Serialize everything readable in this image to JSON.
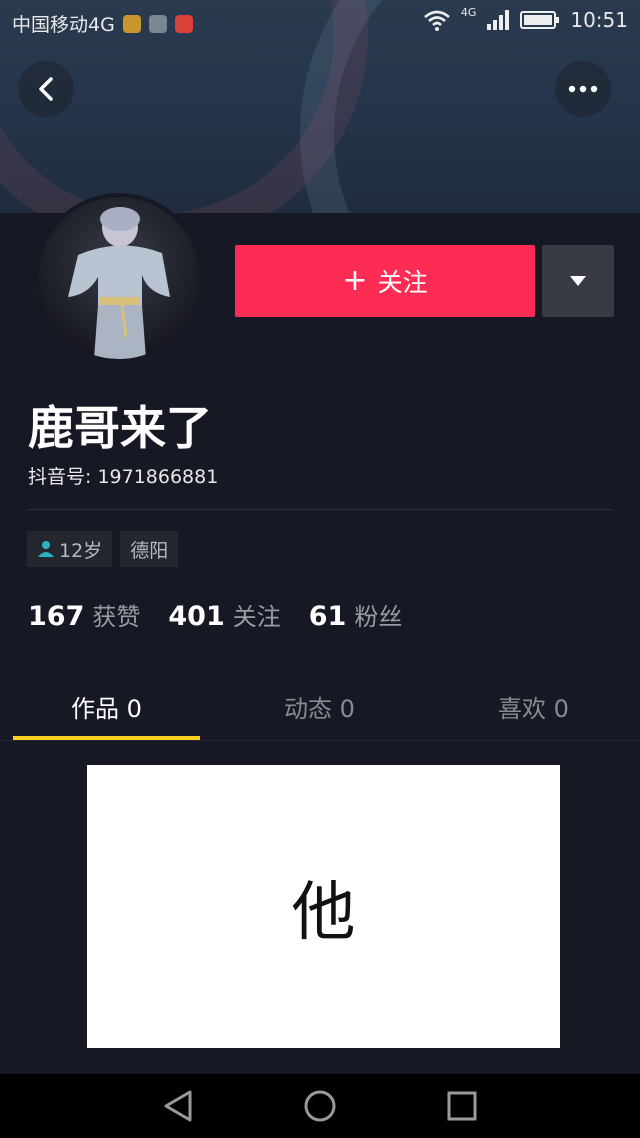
{
  "status_bar": {
    "carrier": "中国移动4G",
    "network": "4G",
    "time": "10:51"
  },
  "header": {
    "back_icon": "chevron-left-icon",
    "more_icon": "more-horizontal-icon"
  },
  "profile": {
    "nickname": "鹿哥来了",
    "account_id": "抖音号: 1971866881",
    "follow_label": "关注",
    "follow_plus": "+",
    "tags": [
      {
        "icon": "person-icon",
        "label": "12岁"
      },
      {
        "label": "德阳"
      }
    ],
    "stats": [
      {
        "num": "167",
        "label": "获赞"
      },
      {
        "num": "401",
        "label": "关注"
      },
      {
        "num": "61",
        "label": "粉丝"
      }
    ]
  },
  "tabs": [
    {
      "label": "作品 0",
      "active": true
    },
    {
      "label": "动态 0",
      "active": false
    },
    {
      "label": "喜欢 0",
      "active": false
    }
  ],
  "content": {
    "card_text": "他"
  },
  "colors": {
    "background": "#161823",
    "follow_button": "#fe2c55",
    "tab_underline": "#facf1f"
  }
}
